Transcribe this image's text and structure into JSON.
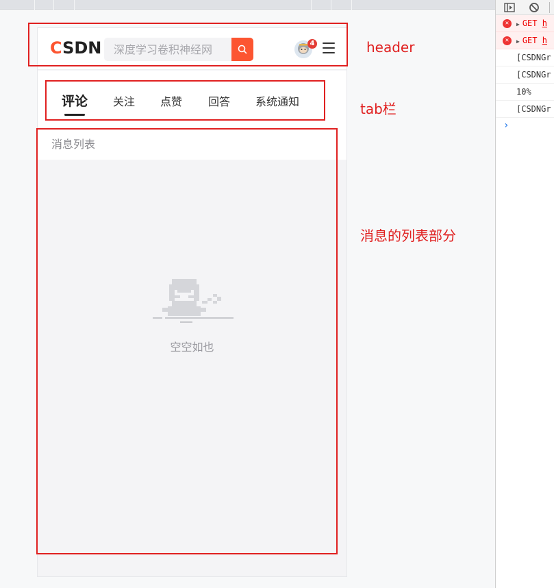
{
  "header": {
    "logo_first": "C",
    "logo_rest": "SDN",
    "search_placeholder": "深度学习卷积神经网",
    "notification_count": "4"
  },
  "tabs": [
    {
      "label": "评论",
      "active": true
    },
    {
      "label": "关注",
      "active": false
    },
    {
      "label": "点赞",
      "active": false
    },
    {
      "label": "回答",
      "active": false
    },
    {
      "label": "系统通知",
      "active": false
    }
  ],
  "list": {
    "title": "消息列表",
    "empty_text": "空空如也"
  },
  "annotations": {
    "header_label": "header",
    "tabbar_label": "tab栏",
    "list_label": "消息的列表部分",
    "color": "#e02020"
  },
  "console": {
    "logs": [
      {
        "type": "error",
        "method": "GET",
        "url": "h"
      },
      {
        "type": "error",
        "method": "GET",
        "url": "h"
      },
      {
        "type": "log",
        "text": "[CSDNGr"
      },
      {
        "type": "log",
        "text": "[CSDNGr"
      },
      {
        "type": "log",
        "text": "10%"
      },
      {
        "type": "log",
        "text": "[CSDNGr"
      }
    ],
    "prompt": "›"
  },
  "colors": {
    "brand": "#fc5531",
    "badge": "#e33d35"
  }
}
